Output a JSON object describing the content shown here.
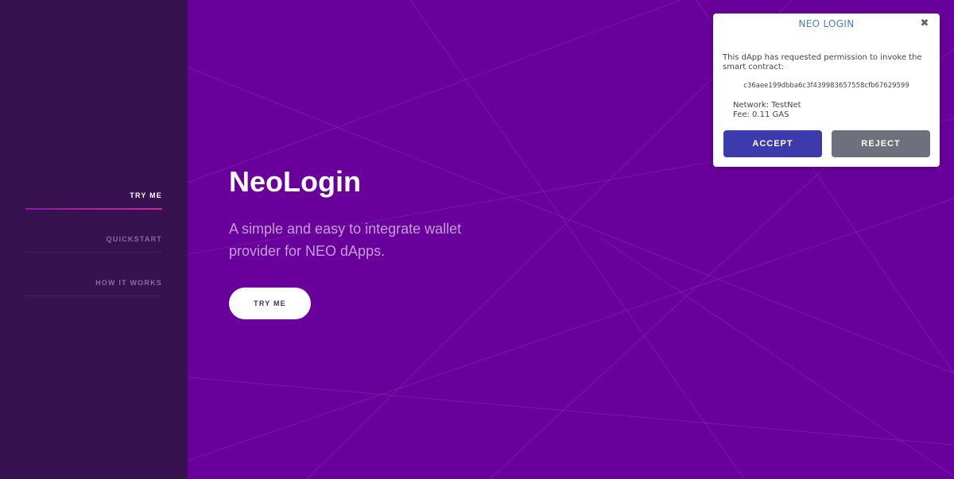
{
  "colors": {
    "sidebar_bg": "#381150",
    "main_bg": "#6a009c",
    "active_underline": "#c5229e",
    "dialog_title": "#4b7bc0",
    "accept_button": "#3d3bac",
    "reject_button": "#6c717c"
  },
  "sidebar": {
    "items": [
      {
        "label": "TRY ME",
        "active": true
      },
      {
        "label": "QUICKSTART",
        "active": false
      },
      {
        "label": "HOW IT WORKS",
        "active": false
      }
    ]
  },
  "hero": {
    "title": "NeoLogin",
    "subtitle": "A simple and easy to integrate wallet provider for NEO dApps.",
    "button_label": "TRY ME"
  },
  "dialog": {
    "title": "NEO LOGIN",
    "close_icon": "close-icon",
    "message": "This dApp has requested permission to invoke the smart contract:",
    "contract_hash": "c36aee199dbba6c3f439983657558cfb67629599",
    "network": "Network: TestNet",
    "fee": "Fee: 0.11 GAS",
    "accept_label": "ACCEPT",
    "reject_label": "REJECT"
  }
}
